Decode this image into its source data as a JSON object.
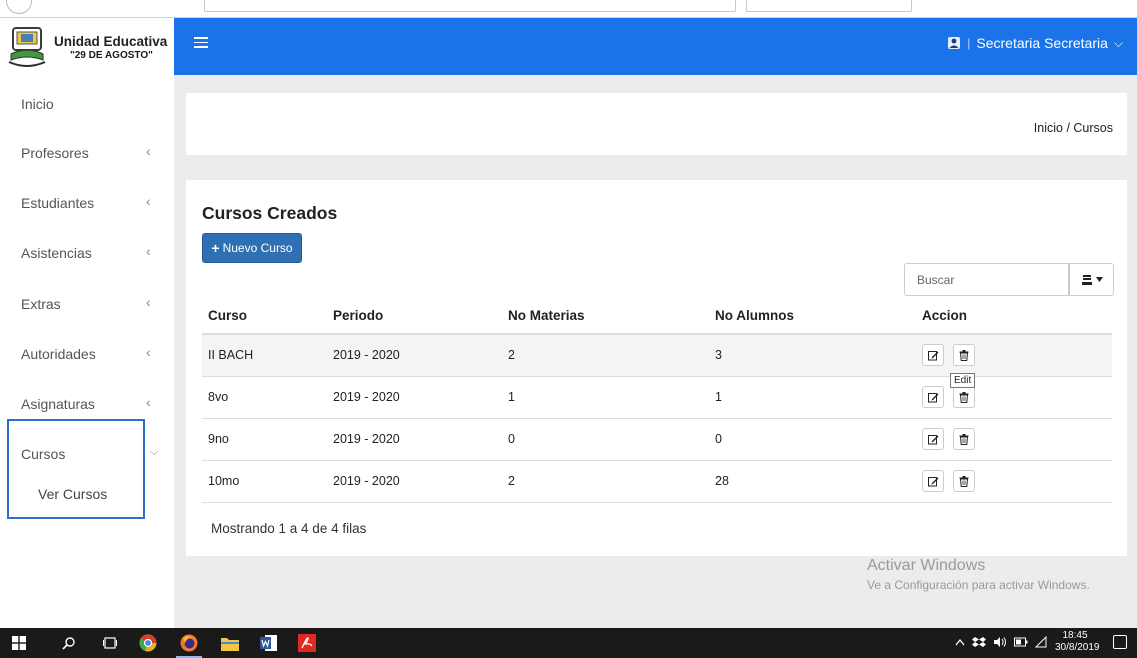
{
  "brand": {
    "title": "Unidad Educativa",
    "subtitle": "\"29 DE AGOSTO\""
  },
  "sidebar": {
    "items": [
      {
        "label": "Inicio",
        "has_chevron": false
      },
      {
        "label": "Profesores",
        "chevron": "‹"
      },
      {
        "label": "Estudiantes",
        "chevron": "‹"
      },
      {
        "label": "Asistencias",
        "chevron": "‹"
      },
      {
        "label": "Extras",
        "chevron": "‹"
      },
      {
        "label": "Autoridades",
        "chevron": "‹"
      },
      {
        "label": "Asignaturas",
        "chevron": "‹"
      },
      {
        "label": "Cursos",
        "chevron": "⌵",
        "expanded": true
      }
    ],
    "sub_items": [
      {
        "label": "Ver Cursos"
      }
    ]
  },
  "header": {
    "user_name": "Secretaria Secretaria",
    "separator": "|",
    "caret": "⌵"
  },
  "breadcrumb": "Inicio / Cursos",
  "panel": {
    "title": "Cursos Creados",
    "new_button_label": "Nuevo Curso",
    "new_button_plus": "+",
    "search_placeholder": "Buscar",
    "columns": [
      "Curso",
      "Periodo",
      "No Materias",
      "No Alumnos",
      "Accion"
    ],
    "rows": [
      {
        "curso": "II BACH",
        "periodo": "2019 - 2020",
        "materias": "2",
        "alumnos": "3"
      },
      {
        "curso": "8vo",
        "periodo": "2019 - 2020",
        "materias": "1",
        "alumnos": "1"
      },
      {
        "curso": "9no",
        "periodo": "2019 - 2020",
        "materias": "0",
        "alumnos": "0"
      },
      {
        "curso": "10mo",
        "periodo": "2019 - 2020",
        "materias": "2",
        "alumnos": "28"
      }
    ],
    "tooltip": "Edit",
    "footer_info": "Mostrando 1 a 4 de 4 filas"
  },
  "watermark": {
    "line1": "Activar Windows",
    "line2": "Ve a Configuración para activar Windows."
  },
  "taskbar": {
    "time": "18:45",
    "date": "30/8/2019"
  },
  "colors": {
    "topbar": "#1a73e8",
    "primary_button": "#2f6fb3",
    "active_box": "#2d6fd0"
  }
}
